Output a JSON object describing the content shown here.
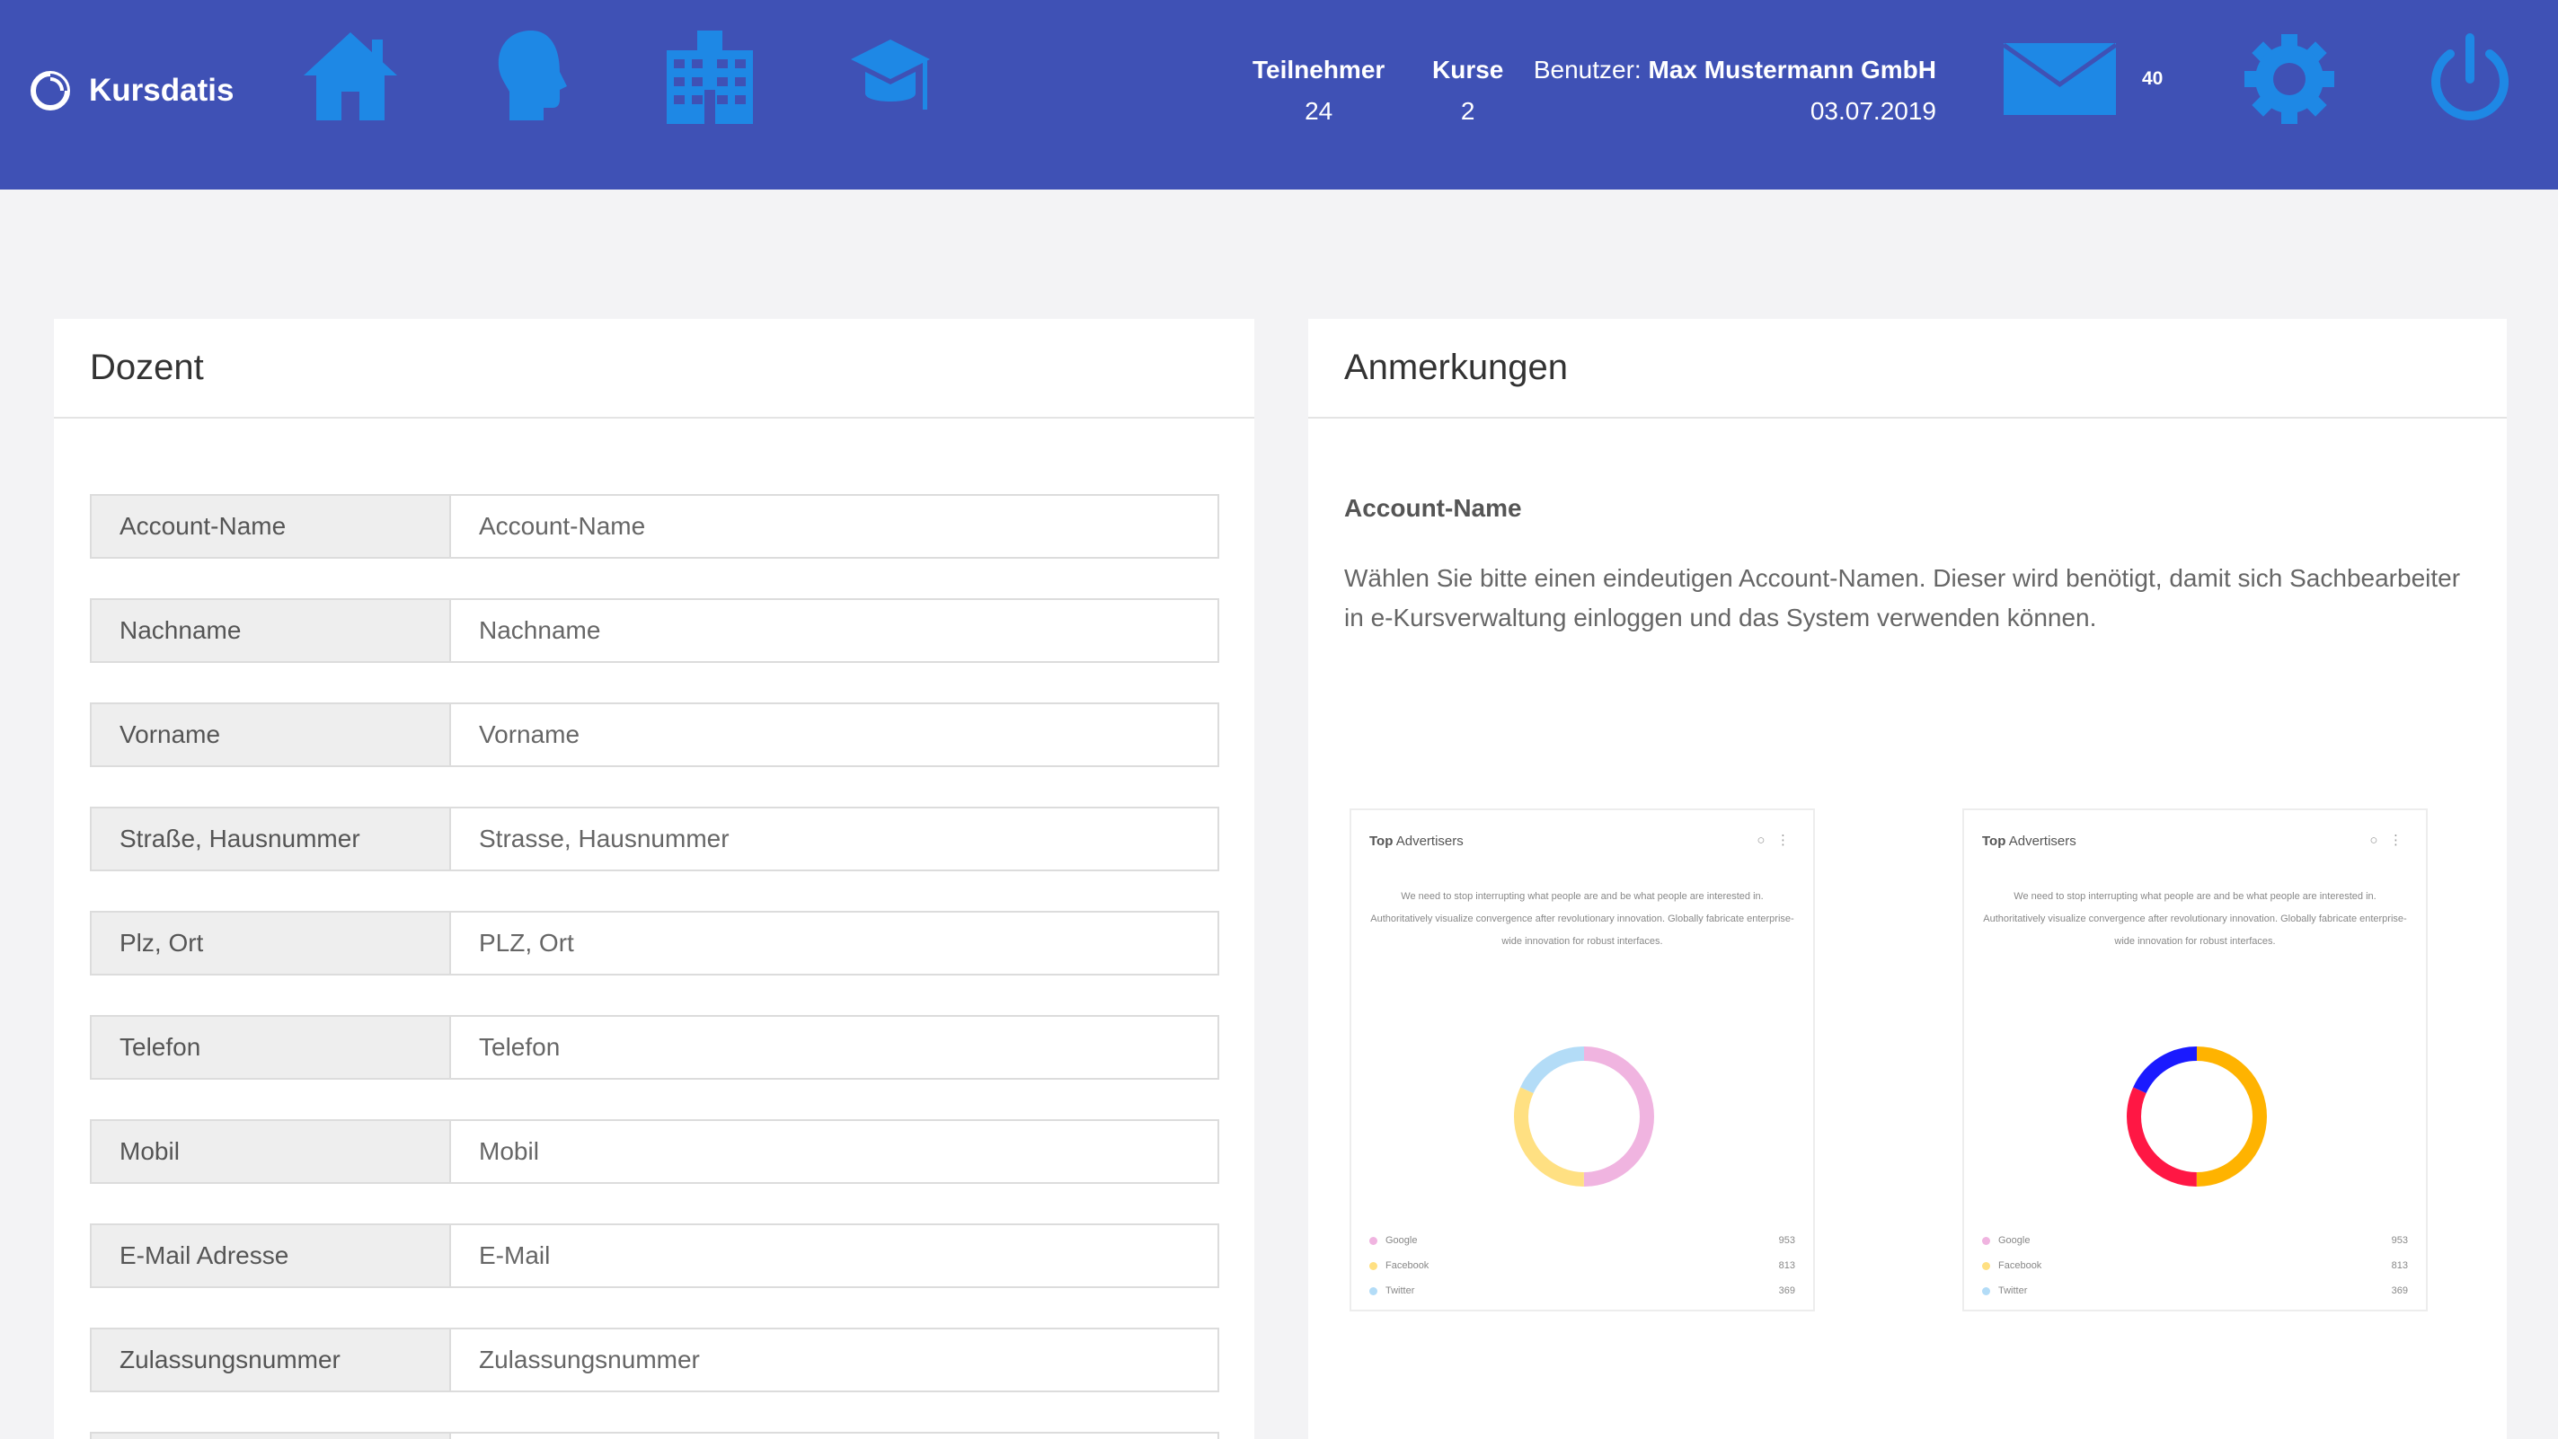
{
  "app": {
    "name": "Kursdatis"
  },
  "nav": {
    "icons": [
      "home-icon",
      "head-profile-icon",
      "school-building-icon",
      "graduation-cap-icon"
    ]
  },
  "header": {
    "stats": [
      {
        "label": "Teilnehmer",
        "value": "24"
      },
      {
        "label": "Kurse",
        "value": "2"
      }
    ],
    "user_prefix": "Benutzer:",
    "user_name": "Max Mustermann GmbH",
    "date": "03.07.2019",
    "mail_count": "40",
    "icon_color": "#1e88e5",
    "bar_color": "#3f51b5"
  },
  "left_card": {
    "title": "Dozent",
    "fields": [
      {
        "label": "Account-Name",
        "placeholder": "Account-Name"
      },
      {
        "label": "Nachname",
        "placeholder": "Nachname"
      },
      {
        "label": "Vorname",
        "placeholder": "Vorname"
      },
      {
        "label": "Straße, Hausnummer",
        "placeholder": "Strasse, Hausnummer"
      },
      {
        "label": "Plz, Ort",
        "placeholder": "PLZ, Ort"
      },
      {
        "label": "Telefon",
        "placeholder": "Telefon"
      },
      {
        "label": "Mobil",
        "placeholder": "Mobil"
      },
      {
        "label": "E-Mail Adresse",
        "placeholder": "E-Mail"
      },
      {
        "label": "Zulassungsnummer",
        "placeholder": "Zulassungsnummer"
      }
    ]
  },
  "right_card": {
    "title": "Anmerkungen",
    "note_title": "Account-Name",
    "note_text": "Wählen Sie bitte einen eindeutigen Account-Namen. Dieser wird benötigt, damit sich Sachbearbeiter in e-Kursverwaltung einloggen und das System verwenden können.",
    "widgets": [
      {
        "title_bold": "Top",
        "title_rest": "Advertisers",
        "desc": "We need to stop interrupting what people are and be what people are interested in. Authoritatively visualize convergence after revolutionary innovation. Globally fabricate enterprise-wide innovation for robust interfaces.",
        "legend": [
          {
            "name": "Google",
            "value": "953",
            "color": "#f0b4e0"
          },
          {
            "name": "Facebook",
            "value": "813",
            "color": "#ffe082"
          },
          {
            "name": "Twitter",
            "value": "369",
            "color": "#b3dcf7"
          }
        ]
      },
      {
        "title_bold": "Top",
        "title_rest": "Advertisers",
        "desc": "We need to stop interrupting what people are and be what people are interested in. Authoritatively visualize convergence after revolutionary innovation. Globally fabricate enterprise-wide innovation for robust interfaces.",
        "legend": [
          {
            "name": "Google",
            "value": "953",
            "color": "#ffb300"
          },
          {
            "name": "Facebook",
            "value": "813",
            "color": "#ff1744"
          },
          {
            "name": "Twitter",
            "value": "369",
            "color": "#1a1aff"
          }
        ]
      }
    ]
  }
}
